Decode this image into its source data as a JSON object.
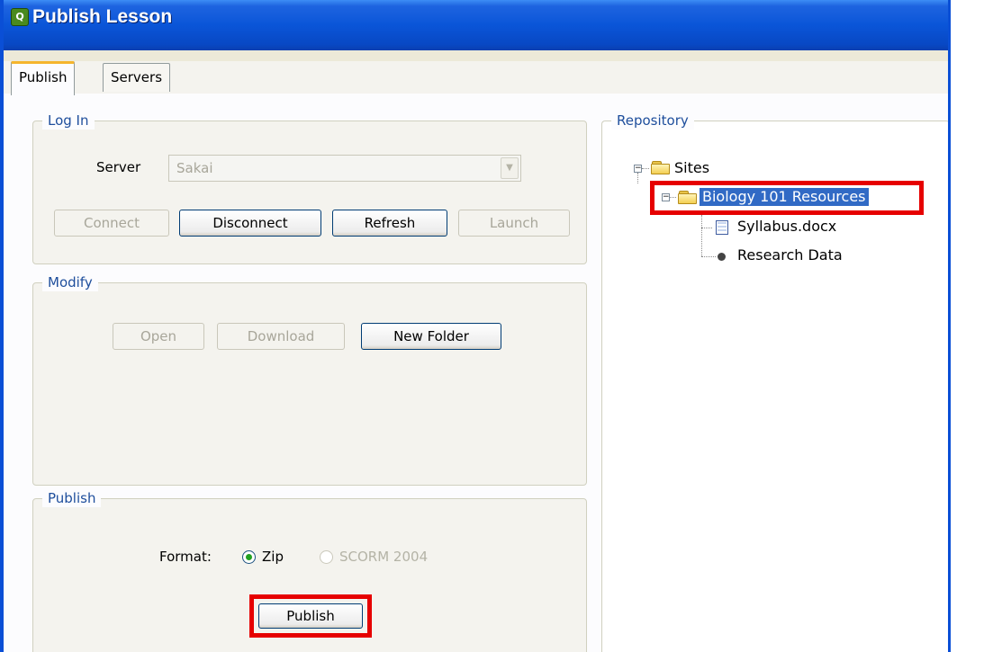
{
  "window": {
    "title": "Publish Lesson"
  },
  "tabs": [
    {
      "label": "Publish",
      "active": true
    },
    {
      "label": "Servers",
      "active": false
    }
  ],
  "login": {
    "group_title": "Log In",
    "server_label": "Server",
    "server_value": "Sakai",
    "buttons": {
      "connect": "Connect",
      "disconnect": "Disconnect",
      "refresh": "Refresh",
      "launch": "Launch"
    }
  },
  "modify": {
    "group_title": "Modify",
    "buttons": {
      "open": "Open",
      "download": "Download",
      "new_folder": "New Folder"
    }
  },
  "publish": {
    "group_title": "Publish",
    "format_label": "Format:",
    "options": [
      {
        "label": "Zip",
        "selected": true,
        "enabled": true
      },
      {
        "label": "SCORM 2004",
        "selected": false,
        "enabled": false
      }
    ],
    "button": "Publish"
  },
  "repository": {
    "group_title": "Repository",
    "tree": {
      "root": "Sites",
      "selected_folder": "Biology 101 Resources",
      "children": [
        "Syllabus.docx",
        "Research Data"
      ]
    }
  },
  "colors": {
    "title_bar": "#0a55d8",
    "selection": "#316ac5",
    "highlight_annotation": "#e60000",
    "group_title_text": "#1e4e9c"
  }
}
